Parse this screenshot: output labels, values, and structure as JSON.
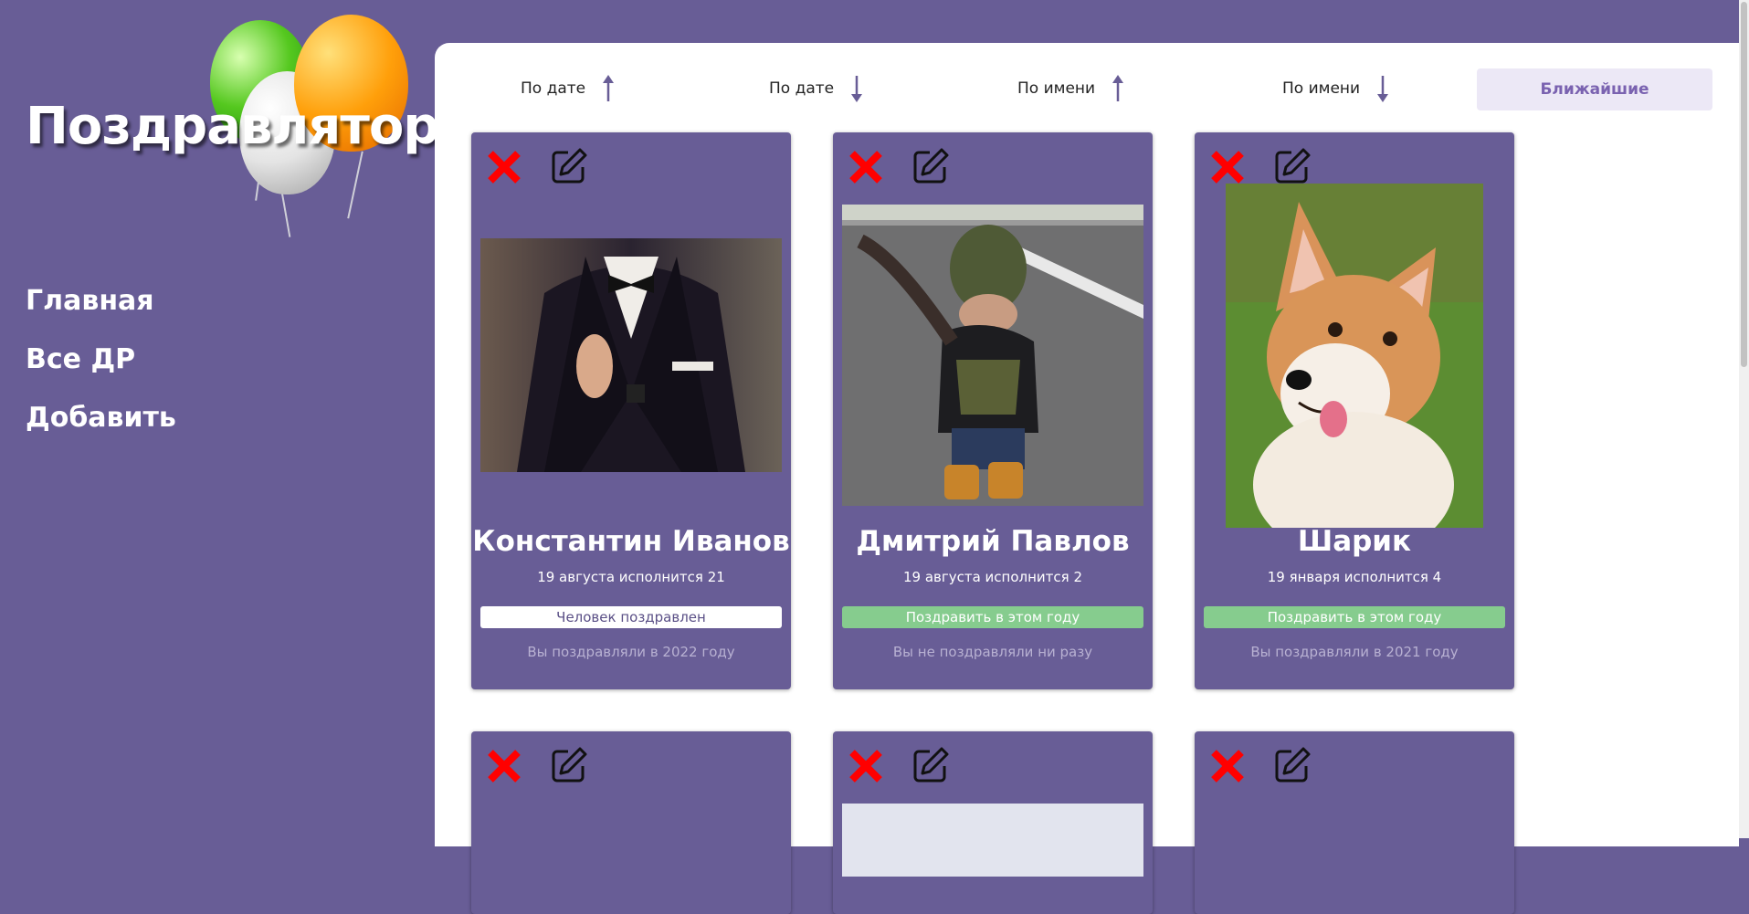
{
  "app": {
    "logo_text": "Поздравлятор"
  },
  "sidebar": {
    "items": [
      {
        "label": "Главная"
      },
      {
        "label": "Все ДР"
      },
      {
        "label": "Добавить"
      }
    ]
  },
  "sortbar": {
    "sort_date_asc": "По дате",
    "sort_date_desc": "По дате",
    "sort_name_asc": "По имени",
    "sort_name_desc": "По имени",
    "nearest": "Ближайшие"
  },
  "cards": [
    {
      "name": "Константин Иванов",
      "date": "19 августа исполнится 21",
      "status": "Человек поздравлен",
      "note": "Вы поздравляли в 2022 году",
      "photo_icon": "man-in-suit-photo"
    },
    {
      "name": "Дмитрий Павлов",
      "date": "19 августа исполнится 2",
      "status": "Поздравить в этом году",
      "note": "Вы не поздравляли ни разу",
      "photo_icon": "toddler-photo"
    },
    {
      "name": "Шарик",
      "date": "19 января исполнится 4",
      "status": "Поздравить в этом году",
      "note": "Вы поздравляли в 2021 году",
      "photo_icon": "corgi-photo"
    }
  ],
  "colors": {
    "background": "#685d96",
    "accent_soft": "#ece8f6",
    "congrats_green": "#86cc8e",
    "delete_red": "#ff0000"
  }
}
